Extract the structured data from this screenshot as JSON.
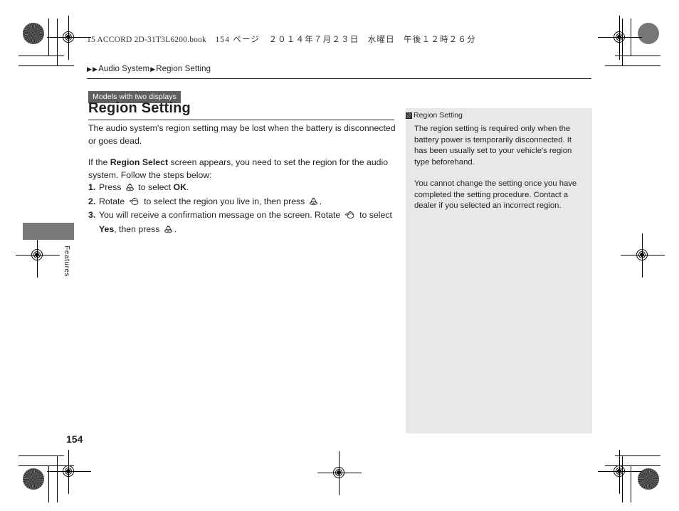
{
  "print_header": {
    "text": "15 ACCORD 2D-31T3L6200.book",
    "page_label": "154 ページ",
    "date": "２０１４年７月２３日",
    "weekday": "水曜日",
    "time": "午後１２時２６分"
  },
  "breadcrumb": {
    "arrow1": "▶",
    "arrow2": "▶",
    "item1": "Audio System",
    "arrow3": "▶",
    "item2": "Region Setting"
  },
  "badge": {
    "label": "Models with two displays"
  },
  "title": "Region Setting",
  "body": {
    "intro": "The audio system's region setting may be lost when the battery is disconnected or goes dead.",
    "lead_before": "If the ",
    "lead_bold": "Region Select",
    "lead_after": " screen appears, you need to set the region for the audio system. Follow the steps below:",
    "steps": [
      {
        "num": "1.",
        "part1": "Press ",
        "icon1": "knob-press-icon",
        "part2": " to select ",
        "bold1": "OK",
        "part3": "."
      },
      {
        "num": "2.",
        "part1": "Rotate ",
        "icon1": "knob-rotate-icon",
        "part2": " to select the region you live in, then press ",
        "icon2": "knob-press-icon",
        "part3": "."
      },
      {
        "num": "3.",
        "part1": "You will receive a confirmation message on the screen. Rotate ",
        "icon1": "knob-rotate-icon",
        "part2": " to select ",
        "bold1": "Yes",
        "part3": ", then press ",
        "icon2": "knob-press-icon",
        "part4": "."
      }
    ]
  },
  "side_panel": {
    "heading": "Region Setting",
    "heading_icon": "reference-book-icon",
    "paragraph1": "The region setting is required only when the battery power is temporarily disconnected. It has been usually set to your vehicle's region type beforehand.",
    "paragraph2": "You cannot change the setting once you have completed the setting procedure. Contact a dealer if you selected an incorrect region."
  },
  "side_tab": {
    "label": "Features"
  },
  "page_number": "154",
  "colors": {
    "badge_background": "#5f5f5f",
    "side_panel_background": "#e8e8e8",
    "side_tab_background": "#7a7a7a",
    "text": "#231f20"
  }
}
